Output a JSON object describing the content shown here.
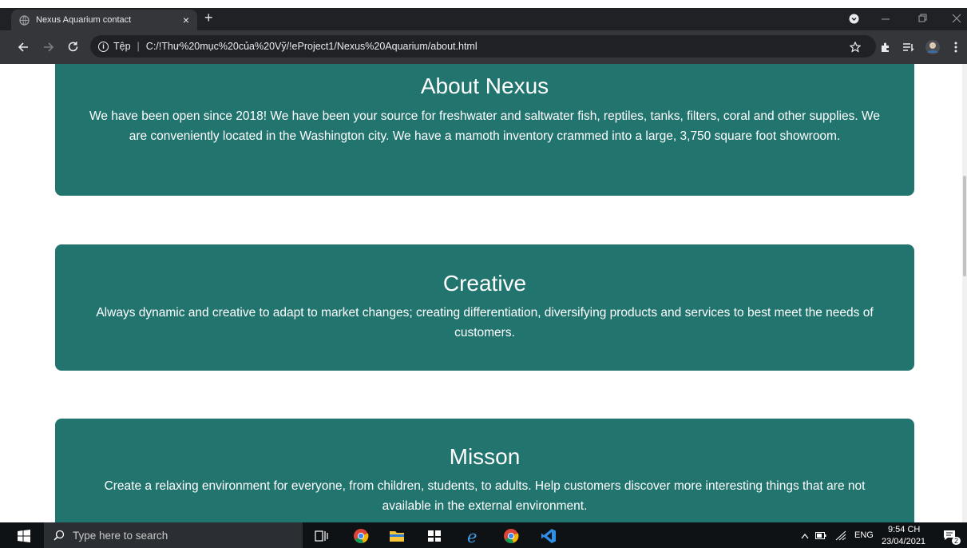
{
  "browser": {
    "tab_title": "Nexus Aquarium contact",
    "tab_close": "×",
    "new_tab": "+",
    "url_prefix": "Tệp",
    "url": "C:/!Thư%20mục%20của%20Vỹ/!eProject1/Nexus%20Aquarium/about.html"
  },
  "cards": [
    {
      "heading": "About Nexus",
      "text": "We have been open since 2018! We have been your source for freshwater and saltwater fish, reptiles, tanks, filters, coral and other supplies. We are conveniently located in the Washington city. We have a mamoth inventory crammed into a large, 3,750 square foot showroom."
    },
    {
      "heading": "Creative",
      "text": "Always dynamic and creative to adapt to market changes; creating differentiation, diversifying products and services to best meet the needs of customers."
    },
    {
      "heading": "Misson",
      "text": "Create a relaxing environment for everyone, from children, students, to adults. Help customers discover more interesting things that are not available in the external environment."
    }
  ],
  "taskbar": {
    "search_placeholder": "Type here to search",
    "language": "ENG",
    "time": "9:54 CH",
    "date": "23/04/2021",
    "notification_count": "2"
  },
  "colors": {
    "card_bg": "#22746f",
    "chrome_dark": "#202124",
    "toolbar": "#35363a"
  }
}
